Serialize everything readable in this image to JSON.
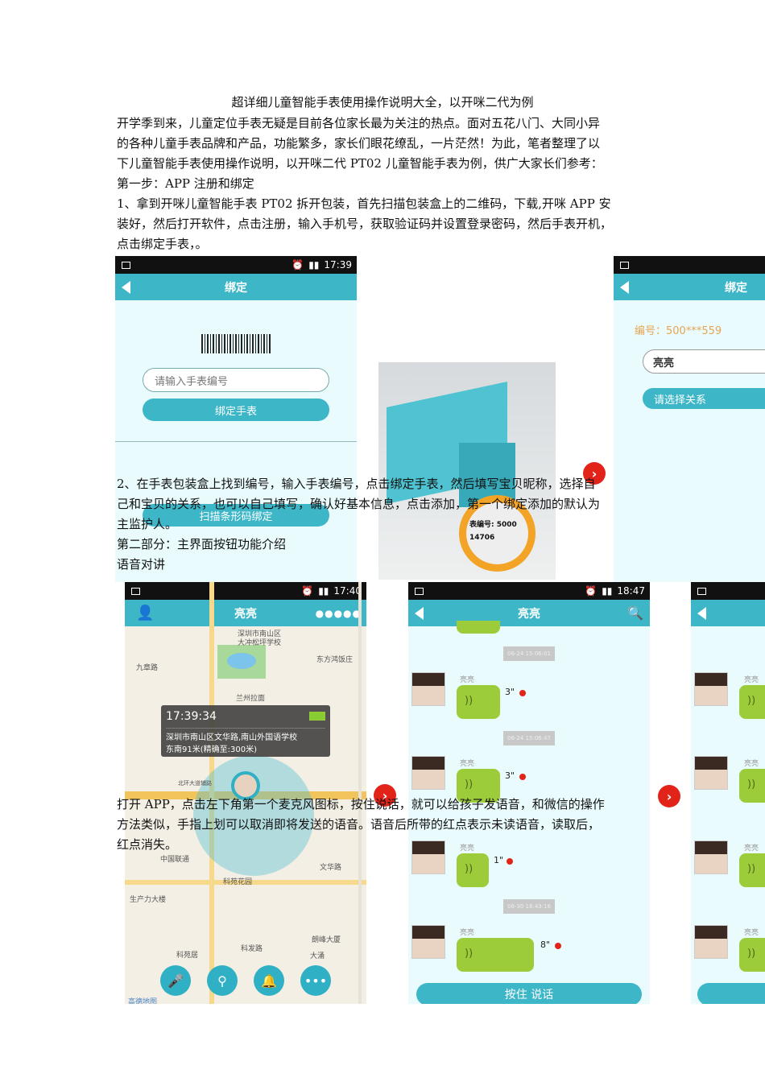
{
  "doc": {
    "title": "超详细儿童智能手表使用操作说明大全，以开咪二代为例",
    "intro_lines": [
      "开学季到来，儿童定位手表无疑是目前各位家长最为关注的热点。面对五花八门、大同小异",
      "的各种儿童手表品牌和产品，功能繁多，家长们眼花缭乱，一片茫然！为此，笔者整理了以",
      "下儿童智能手表使用操作说明，以开咪二代 PT02 儿童智能手表为例，供广大家长们参考："
    ],
    "step1_heading": "第一步：APP 注册和绑定",
    "step1_lines": [
      "1、拿到开咪儿童智能手表 PT02 拆开包装，首先扫描包装盒上的二维码，下载,开咪 APP 安",
      "装好，然后打开软件，点击注册，输入手机号，获取验证码并设置登录密码，然后手表开机，",
      "点击绑定手表，。"
    ],
    "step2_lines": [
      "2、在手表包装盒上找到编号，输入手表编号，点击绑定手表，然后填写宝贝昵称，选择自",
      "己和宝贝的关系，也可以自己填写，确认好基本信息，点击添加，第一个绑定添加的默认为",
      "主监护人。"
    ],
    "part2_heading": "第二部分：主界面按钮功能介绍",
    "voice_heading": "语音对讲",
    "voice_lines": [
      "打开 APP，点击左下角第一个麦克风图标，按住说话，就可以给孩子发语音，和微信的操作",
      "方法类似，手指上划可以取消即将发送的语音。语音后所带的红点表示未读语音，读取后，",
      "红点消失。"
    ]
  },
  "bind_screen": {
    "time": "17:39",
    "title": "绑定",
    "input_placeholder": "请输入手表编号",
    "bind_button": "绑定手表",
    "scan_button": "扫描条形码绑定"
  },
  "box_photo": {
    "label_line1": "表编号: 5000",
    "label_line2": "14706"
  },
  "bind_screen2": {
    "title": "绑定",
    "serial": "编号：500***559",
    "nickname": "亮亮",
    "relation_button": "请选择关系"
  },
  "map_screen": {
    "time": "17:40",
    "title": "亮亮",
    "popup_time": "17:39:34",
    "popup_addr1": "深圳市南山区文华路,南山外国语学校",
    "popup_addr2": "东南91米(精确至:300米)",
    "labels": [
      "深圳市南山区",
      "大冲松坪学校",
      "九章路",
      "东方鸿饭庄",
      "兰州拉面",
      "中国联通",
      "科苑花园",
      "文华路",
      "生产力大楼",
      "朗峰大厦",
      "科苑居",
      "科发路",
      "大涌",
      "北环大道辅路",
      "高德地图"
    ]
  },
  "chat_screen": {
    "time": "18:47",
    "title": "亮亮",
    "messages": [
      {
        "timestamp": "06-24 15:06:01",
        "name": "亮亮",
        "duration": "3\""
      },
      {
        "timestamp": "06-24 15:06:47",
        "name": "亮亮",
        "duration": "3\""
      },
      {
        "timestamp": "",
        "name": "亮亮",
        "duration": "1\""
      },
      {
        "timestamp": "06-30 18:43:16",
        "name": "亮亮",
        "duration": "8\""
      }
    ],
    "hold_button": "按住 说话"
  },
  "chat_screen2": {
    "names": [
      "亮亮",
      "亮亮",
      "亮亮",
      "亮亮"
    ]
  },
  "colors": {
    "accent": "#3db6c8",
    "bubble": "#9ccc3a",
    "unread": "#e2231a"
  }
}
